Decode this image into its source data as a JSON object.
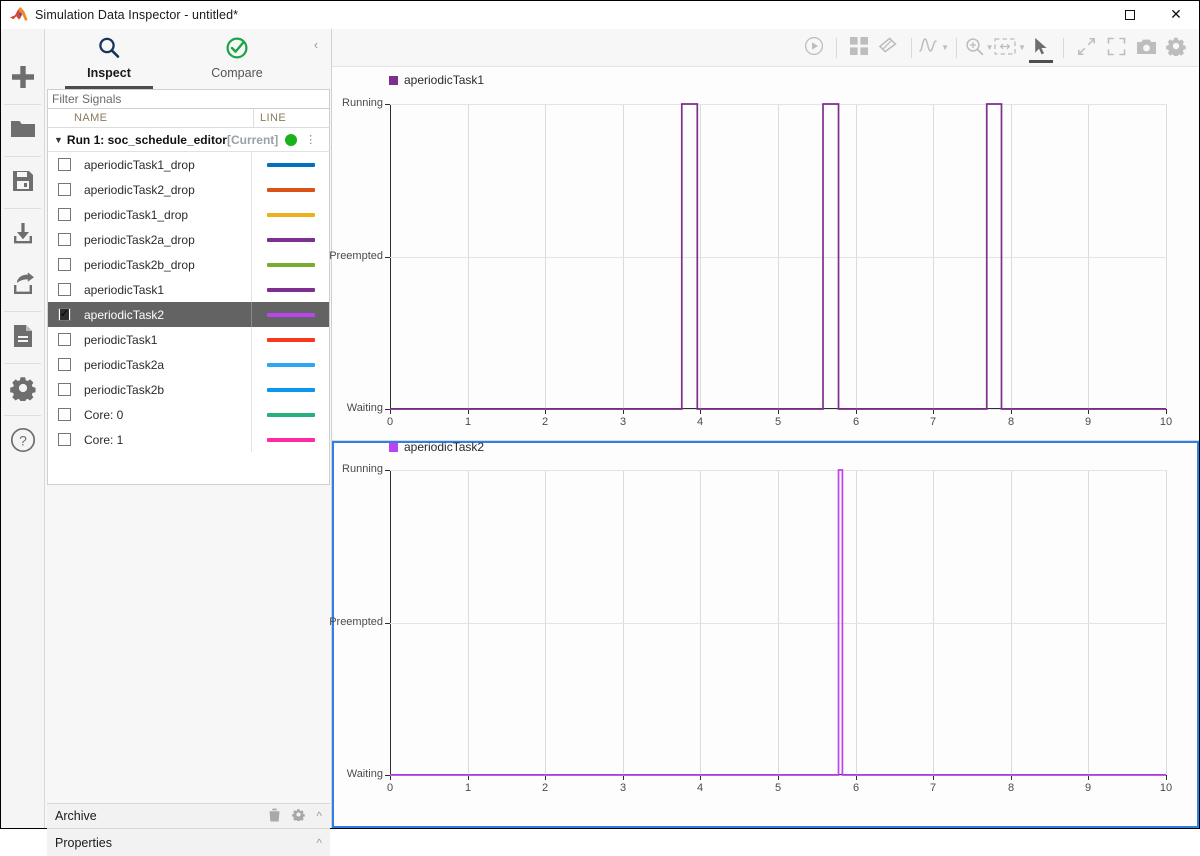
{
  "window": {
    "title": "Simulation Data Inspector - untitled*",
    "maximize_label": "Maximize",
    "close_label": "Close"
  },
  "rail": {
    "items": [
      {
        "name": "new-run-button",
        "icon": "plus-icon",
        "label": "New"
      },
      {
        "name": "open-button",
        "icon": "folder-icon",
        "label": "Open"
      },
      {
        "name": "save-button",
        "icon": "save-icon",
        "label": "Save"
      },
      {
        "name": "import-button",
        "icon": "import-icon",
        "label": "Import"
      },
      {
        "name": "export-button",
        "icon": "export-icon",
        "label": "Export"
      },
      {
        "name": "report-button",
        "icon": "document-icon",
        "label": "Report"
      },
      {
        "name": "preferences-button",
        "icon": "gear-icon",
        "label": "Preferences"
      },
      {
        "name": "help-button",
        "icon": "question-circle-icon",
        "label": "Help"
      }
    ]
  },
  "browser": {
    "tabs": [
      {
        "label": "Inspect",
        "icon": "search-icon",
        "active": true
      },
      {
        "label": "Compare",
        "icon": "check-circle-icon",
        "active": false
      }
    ],
    "collapse_icon": "chevron-left-icon",
    "filter": {
      "placeholder": "Filter Signals",
      "value": ""
    },
    "columns": {
      "name": "NAME",
      "line": "LINE"
    },
    "run": {
      "label": "Run 1: soc_schedule_editor",
      "suffix": "[Current]",
      "status_color": "#19b319",
      "expanded": true
    },
    "signals": [
      {
        "name": "aperiodicTask1_drop",
        "color": "#0072bd",
        "checked": false,
        "selected": false
      },
      {
        "name": "aperiodicTask2_drop",
        "color": "#d95319",
        "checked": false,
        "selected": false
      },
      {
        "name": "periodicTask1_drop",
        "color": "#edb120",
        "checked": false,
        "selected": false
      },
      {
        "name": "periodicTask2a_drop",
        "color": "#7e2f8e",
        "checked": false,
        "selected": false
      },
      {
        "name": "periodicTask2b_drop",
        "color": "#77ac30",
        "checked": false,
        "selected": false
      },
      {
        "name": "aperiodicTask1",
        "color": "#7e2f8e",
        "checked": false,
        "selected": false
      },
      {
        "name": "aperiodicTask2",
        "color": "#bb44f0",
        "checked": true,
        "selected": true
      },
      {
        "name": "periodicTask1",
        "color": "#f93822",
        "checked": false,
        "selected": false
      },
      {
        "name": "periodicTask2a",
        "color": "#2aa8f5",
        "checked": false,
        "selected": false
      },
      {
        "name": "periodicTask2b",
        "color": "#0d96f0",
        "checked": false,
        "selected": false
      },
      {
        "name": "Core: 0",
        "color": "#27b07b",
        "checked": false,
        "selected": false
      },
      {
        "name": "Core: 1",
        "color": "#ff2ba3",
        "checked": false,
        "selected": false
      }
    ],
    "archive": {
      "label": "Archive",
      "icons": [
        "trash-icon",
        "gear-icon",
        "chevron-up-icon"
      ]
    },
    "properties": {
      "label": "Properties",
      "icons": [
        "chevron-up-icon"
      ]
    }
  },
  "plot_toolbar": {
    "buttons": [
      {
        "name": "run-button",
        "icon": "play-circle-icon",
        "label": "Run",
        "active": false
      },
      {
        "name": "layout-button",
        "icon": "grid-layout-icon",
        "label": "Layout",
        "active": false
      },
      {
        "name": "clear-button",
        "icon": "eraser-icon",
        "label": "Clear",
        "active": false
      },
      {
        "name": "normalize-button",
        "icon": "waveform-icon",
        "label": "Normalize",
        "active": false,
        "dropdown": true
      },
      {
        "name": "zoom-in-button",
        "icon": "zoom-in-icon",
        "label": "Zoom In",
        "active": false,
        "dropdown": true
      },
      {
        "name": "fit-to-view-button",
        "icon": "fit-to-view-icon",
        "label": "Fit to View",
        "active": false,
        "dropdown": true
      },
      {
        "name": "pointer-button",
        "icon": "cursor-arrow-icon",
        "label": "Pointer",
        "active": true
      },
      {
        "name": "zoom-out-full-button",
        "icon": "expand-diagonal-icon",
        "label": "Expand",
        "active": false
      },
      {
        "name": "fullscreen-button",
        "icon": "fullscreen-icon",
        "label": "Full Screen",
        "active": false
      },
      {
        "name": "snapshot-button",
        "icon": "camera-icon",
        "label": "Snapshot",
        "active": false
      },
      {
        "name": "settings-button",
        "icon": "gear-icon",
        "label": "Settings",
        "active": false
      }
    ]
  },
  "chart_data": [
    {
      "type": "line",
      "id": "plot-1",
      "title": "",
      "legend": [
        {
          "name": "aperiodicTask1",
          "color": "#7e2f8e"
        }
      ],
      "legend_position": "top-left",
      "xlabel": "",
      "ylabel": "",
      "xlim": [
        0,
        10
      ],
      "xticks": [
        0,
        1,
        2,
        3,
        4,
        5,
        6,
        7,
        8,
        9,
        10
      ],
      "xticklabels": [
        "0",
        "1",
        "2",
        "3",
        "4",
        "5",
        "6",
        "7",
        "8",
        "9",
        "10"
      ],
      "ylim": [
        0,
        2
      ],
      "yticks": [
        0,
        1,
        2
      ],
      "yticklabels": [
        "Waiting",
        "Preempted",
        "Running"
      ],
      "grid": true,
      "series": [
        {
          "name": "aperiodicTask1",
          "color": "#7e2f8e",
          "interpolation": "stairs",
          "x": [
            0,
            3.76,
            3.96,
            5.58,
            5.78,
            7.69,
            7.88,
            10
          ],
          "y": [
            0,
            2,
            0,
            2,
            0,
            2,
            0,
            0
          ]
        }
      ]
    },
    {
      "type": "line",
      "id": "plot-2",
      "title": "",
      "legend": [
        {
          "name": "aperiodicTask2",
          "color": "#bb44f0"
        }
      ],
      "legend_position": "top-left",
      "xlabel": "",
      "ylabel": "",
      "xlim": [
        0,
        10
      ],
      "xticks": [
        0,
        1,
        2,
        3,
        4,
        5,
        6,
        7,
        8,
        9,
        10
      ],
      "xticklabels": [
        "0",
        "1",
        "2",
        "3",
        "4",
        "5",
        "6",
        "7",
        "8",
        "9",
        "10"
      ],
      "ylim": [
        0,
        2
      ],
      "yticks": [
        0,
        1,
        2
      ],
      "yticklabels": [
        "Waiting",
        "Preempted",
        "Running"
      ],
      "grid": true,
      "selected": true,
      "series": [
        {
          "name": "aperiodicTask2",
          "color": "#bb44f0",
          "interpolation": "stairs",
          "x": [
            0,
            5.78,
            5.83,
            10
          ],
          "y": [
            0,
            2,
            0,
            0
          ]
        }
      ]
    }
  ]
}
